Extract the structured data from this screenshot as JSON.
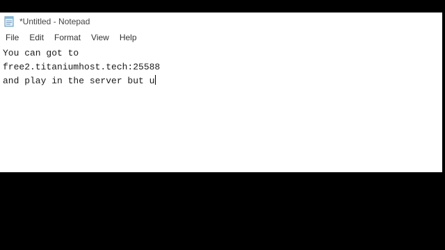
{
  "window": {
    "title": "*Untitled - Notepad"
  },
  "menu": {
    "items": [
      "File",
      "Edit",
      "Format",
      "View",
      "Help"
    ]
  },
  "editor": {
    "lines": [
      "You can got to",
      "free2.titaniumhost.tech:25588",
      "and play in the server but u"
    ]
  },
  "colors": {
    "window_bg": "#ffffff",
    "outer_bg": "#000000",
    "text": "#1a1a1a"
  },
  "icons": {
    "app": "notepad-icon"
  }
}
